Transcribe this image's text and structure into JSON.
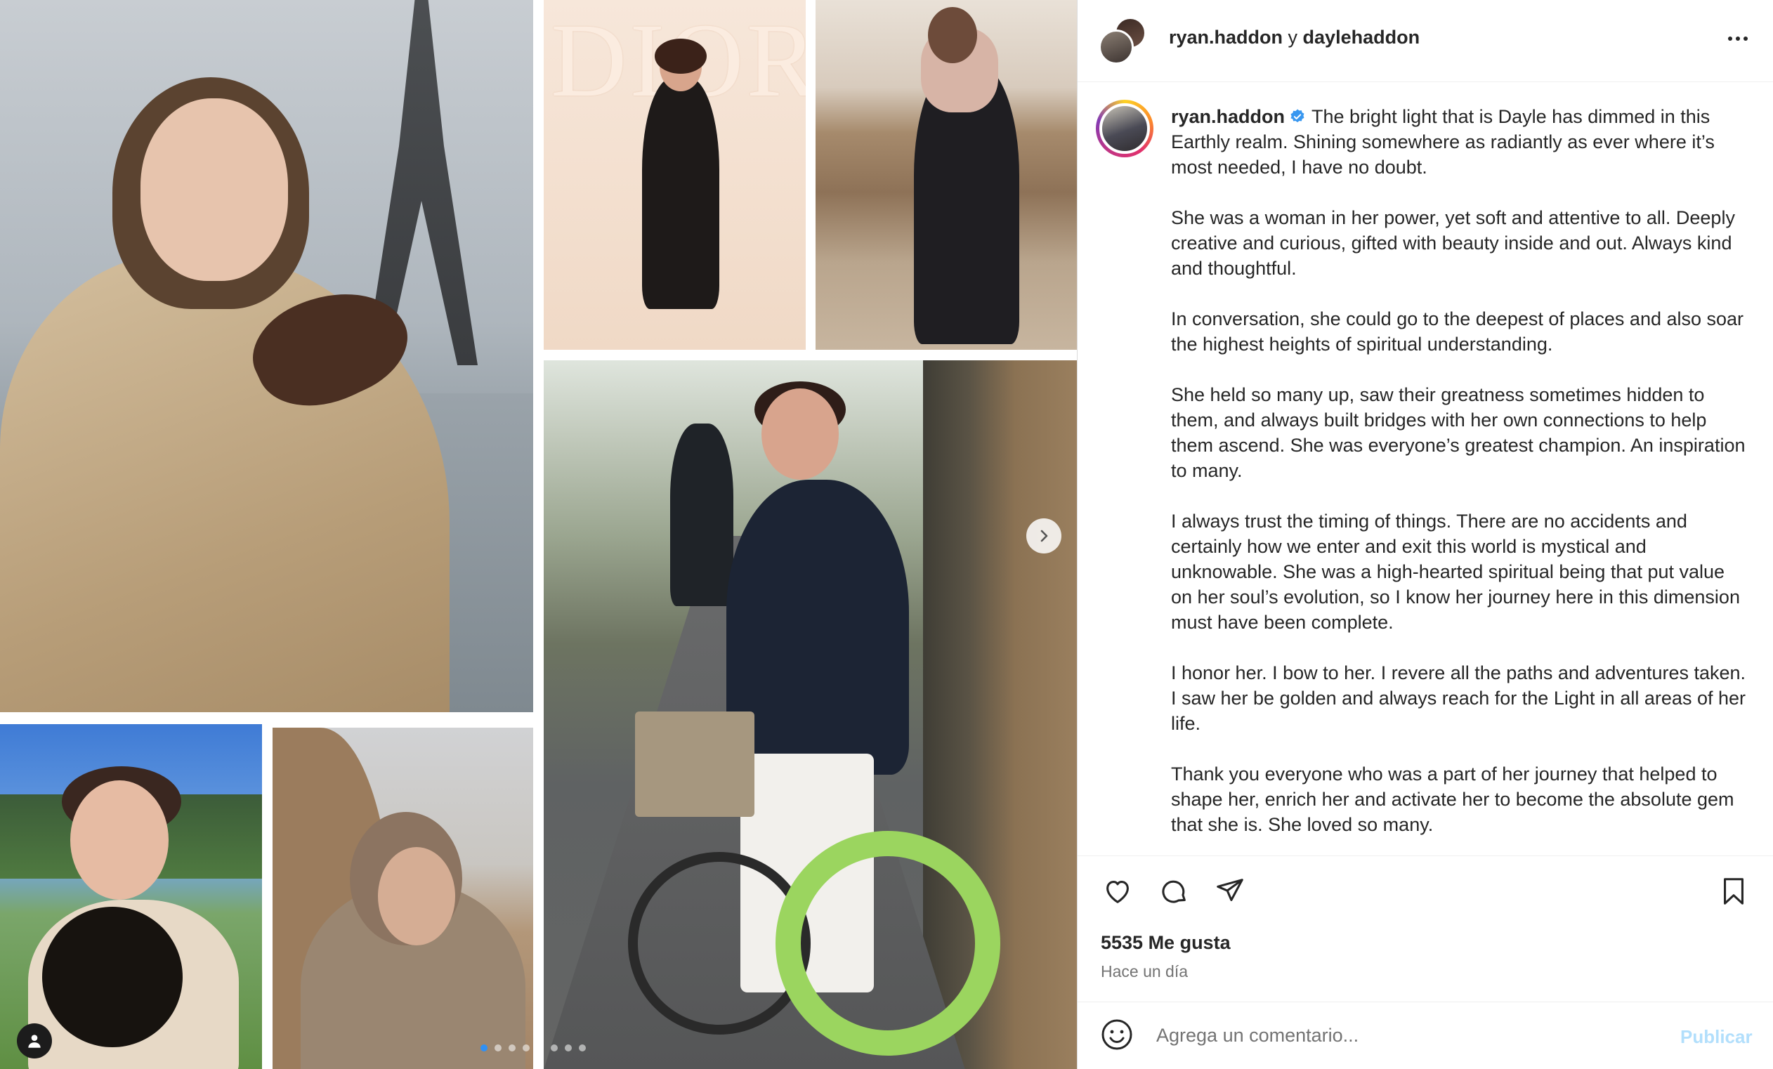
{
  "post": {
    "header_user1": "ryan.haddon",
    "header_join": "y",
    "header_user2": "daylehaddon",
    "caption_user": "ryan.haddon",
    "caption_paragraphs": [
      "The bright light that is Dayle has dimmed in this Earthly realm. Shining somewhere as radiantly as ever where it’s most needed, I have no doubt.",
      "She was a woman in her power, yet soft and attentive to all. Deeply creative and curious, gifted with beauty inside and out. Always kind and thoughtful.",
      "In conversation, she could go to the deepest of places and also soar the highest heights of spiritual understanding.",
      "She held so many up, saw their greatness sometimes hidden to them, and always built bridges with her own connections to help them ascend. She was everyone’s greatest champion. An inspiration to many.",
      "I always trust the timing of things. There are no accidents and certainly how we enter and exit this world is mystical and unknowable. She was a high-hearted spiritual being that put value on her soul’s evolution, so I know her journey here in this dimension must have been complete.",
      "I honor her. I bow to her. I revere all the paths and adventures taken. I saw her be golden and always reach for the Light in all areas of her life.",
      "Thank you everyone who was a part of her journey that helped to shape her, enrich her and activate her to become the absolute gem that she is. She loved so many."
    ],
    "likes": "5535 Me gusta",
    "time": "Hace un día",
    "comment_placeholder": "Agrega un comentario...",
    "publish_label": "Publicar"
  },
  "media": {
    "logo_text": "DIOR",
    "carousel_total": 8,
    "carousel_active": 1
  },
  "colors": {
    "verified": "#3897f0",
    "publish_disabled": "#b2dffc",
    "bike_green": "#9bd55f"
  },
  "icons": [
    "more-icon",
    "verified-icon",
    "heart-icon",
    "comment-icon",
    "share-icon",
    "bookmark-icon",
    "emoji-icon",
    "chevron-right-icon",
    "user-tag-icon"
  ]
}
